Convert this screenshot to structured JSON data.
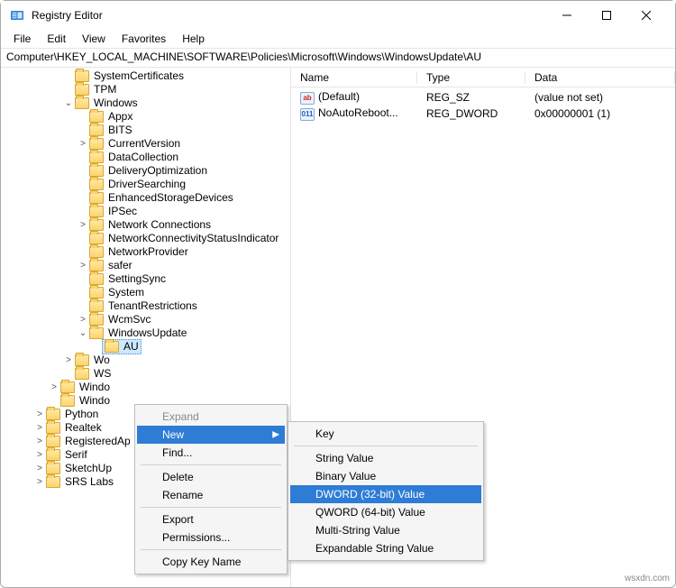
{
  "window": {
    "title": "Registry Editor"
  },
  "menu": {
    "file": "File",
    "edit": "Edit",
    "view": "View",
    "favorites": "Favorites",
    "help": "Help"
  },
  "address": "Computer\\HKEY_LOCAL_MACHINE\\SOFTWARE\\Policies\\Microsoft\\Windows\\WindowsUpdate\\AU",
  "columns": {
    "name": "Name",
    "type": "Type",
    "data": "Data"
  },
  "values": [
    {
      "icon": "ab",
      "name": "(Default)",
      "type": "REG_SZ",
      "data": "(value not set)"
    },
    {
      "icon": "011",
      "name": "NoAutoReboot...",
      "type": "REG_DWORD",
      "data": "0x00000001 (1)"
    }
  ],
  "tree": [
    {
      "indent": 68,
      "exp": "",
      "label": "SystemCertificates"
    },
    {
      "indent": 68,
      "exp": "",
      "label": "TPM"
    },
    {
      "indent": 68,
      "exp": "v",
      "label": "Windows"
    },
    {
      "indent": 84,
      "exp": "",
      "label": "Appx"
    },
    {
      "indent": 84,
      "exp": "",
      "label": "BITS"
    },
    {
      "indent": 84,
      "exp": ">",
      "label": "CurrentVersion"
    },
    {
      "indent": 84,
      "exp": "",
      "label": "DataCollection"
    },
    {
      "indent": 84,
      "exp": "",
      "label": "DeliveryOptimization"
    },
    {
      "indent": 84,
      "exp": "",
      "label": "DriverSearching"
    },
    {
      "indent": 84,
      "exp": "",
      "label": "EnhancedStorageDevices"
    },
    {
      "indent": 84,
      "exp": "",
      "label": "IPSec"
    },
    {
      "indent": 84,
      "exp": ">",
      "label": "Network Connections"
    },
    {
      "indent": 84,
      "exp": "",
      "label": "NetworkConnectivityStatusIndicator"
    },
    {
      "indent": 84,
      "exp": "",
      "label": "NetworkProvider"
    },
    {
      "indent": 84,
      "exp": ">",
      "label": "safer"
    },
    {
      "indent": 84,
      "exp": "",
      "label": "SettingSync"
    },
    {
      "indent": 84,
      "exp": "",
      "label": "System"
    },
    {
      "indent": 84,
      "exp": "",
      "label": "TenantRestrictions"
    },
    {
      "indent": 84,
      "exp": ">",
      "label": "WcmSvc"
    },
    {
      "indent": 84,
      "exp": "v",
      "label": "WindowsUpdate"
    },
    {
      "indent": 100,
      "exp": "",
      "label": "AU",
      "selected": true
    },
    {
      "indent": 68,
      "exp": ">",
      "label": "Wo"
    },
    {
      "indent": 68,
      "exp": "",
      "label": "WS"
    },
    {
      "indent": 52,
      "exp": ">",
      "label": "Windo"
    },
    {
      "indent": 52,
      "exp": "",
      "label": "Windo"
    },
    {
      "indent": 36,
      "exp": ">",
      "label": "Python"
    },
    {
      "indent": 36,
      "exp": ">",
      "label": "Realtek"
    },
    {
      "indent": 36,
      "exp": ">",
      "label": "RegisteredAp"
    },
    {
      "indent": 36,
      "exp": ">",
      "label": "Serif"
    },
    {
      "indent": 36,
      "exp": ">",
      "label": "SketchUp"
    },
    {
      "indent": 36,
      "exp": ">",
      "label": "SRS Labs"
    }
  ],
  "ctx": {
    "expand": "Expand",
    "new": "New",
    "find": "Find...",
    "delete": "Delete",
    "rename": "Rename",
    "export": "Export",
    "permissions": "Permissions...",
    "copy_key_name": "Copy Key Name"
  },
  "newmenu": {
    "key": "Key",
    "string": "String Value",
    "binary": "Binary Value",
    "dword": "DWORD (32-bit) Value",
    "qword": "QWORD (64-bit) Value",
    "multi": "Multi-String Value",
    "expand": "Expandable String Value"
  },
  "watermark": "wsxdn.com"
}
